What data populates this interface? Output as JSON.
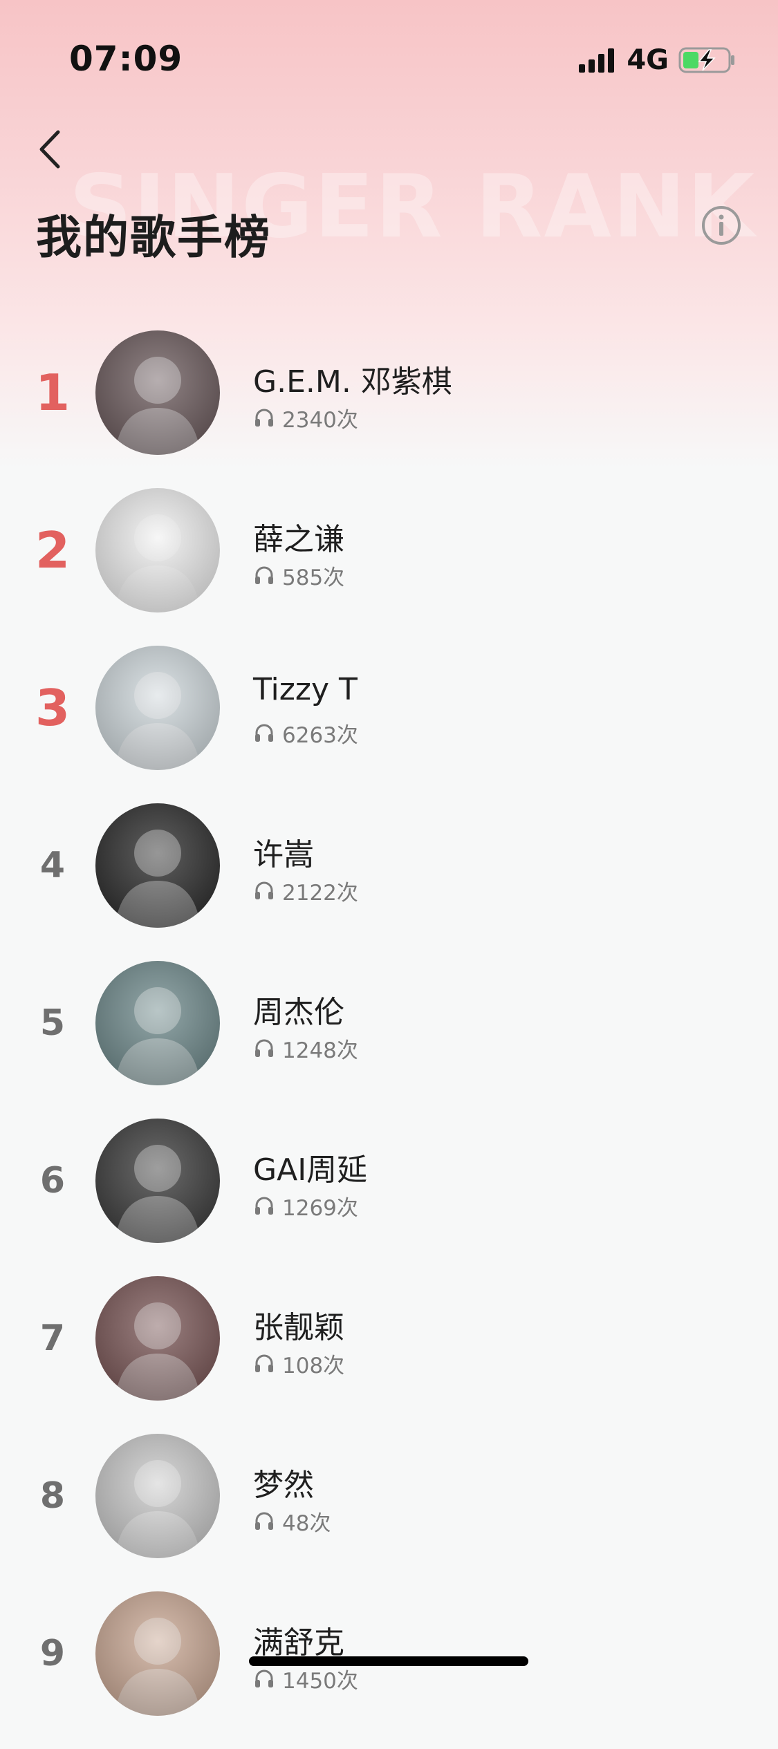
{
  "status_bar": {
    "time": "07:09",
    "network": "4G",
    "icons": [
      "signal-icon",
      "battery-charging-icon"
    ]
  },
  "header": {
    "back_icon": "chevron-left-icon",
    "watermark": "SINGER RANK",
    "title": "我的歌手榜",
    "info_icon": "info-icon"
  },
  "colors": {
    "accent_rank": "#e2615f",
    "rank_default": "#6f6f6f",
    "header_gradient_top": "#f7c4c6",
    "background": "#f7f8f8"
  },
  "rankings": [
    {
      "rank": "1",
      "name": "G.E.M. 邓紫棋",
      "count": "2340次",
      "top": true,
      "avatar_color": "#6b5a5c"
    },
    {
      "rank": "2",
      "name": "薛之谦",
      "count": "585次",
      "top": true,
      "avatar_color": "#eeeeee"
    },
    {
      "rank": "3",
      "name": "Tizzy T",
      "count": "6263次",
      "top": true,
      "avatar_color": "#cfd8dc"
    },
    {
      "rank": "4",
      "name": "许嵩",
      "count": "2122次",
      "top": false,
      "avatar_color": "#2a2a2a"
    },
    {
      "rank": "5",
      "name": "周杰伦",
      "count": "1248次",
      "top": false,
      "avatar_color": "#6f8a8c"
    },
    {
      "rank": "6",
      "name": "GAI周延",
      "count": "1269次",
      "top": false,
      "avatar_color": "#3a3a3a"
    },
    {
      "rank": "7",
      "name": "张靓颖",
      "count": "108次",
      "top": false,
      "avatar_color": "#7a5656"
    },
    {
      "rank": "8",
      "name": "梦然",
      "count": "48次",
      "top": false,
      "avatar_color": "#c9c9c9"
    },
    {
      "rank": "9",
      "name": "满舒克",
      "count": "1450次",
      "top": false,
      "avatar_color": "#caa894"
    }
  ]
}
